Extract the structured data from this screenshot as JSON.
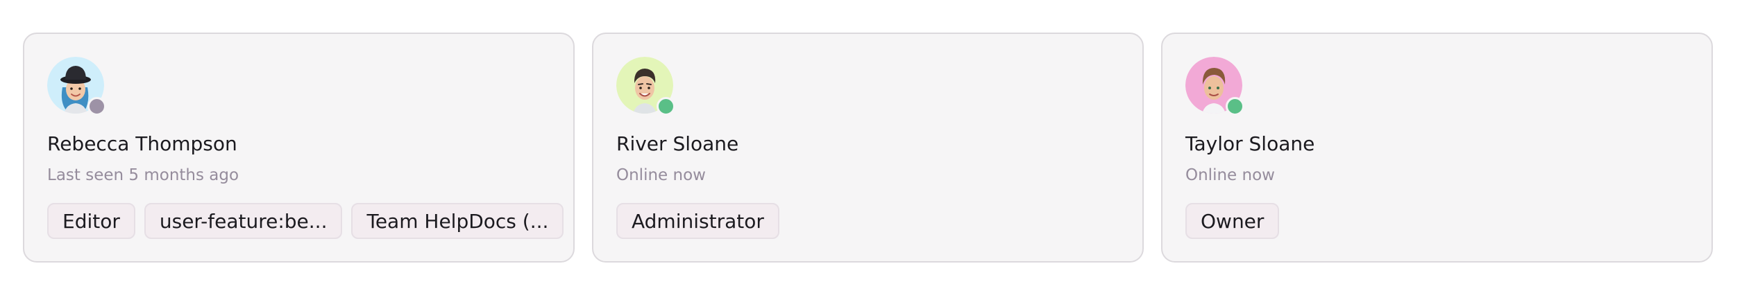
{
  "members": [
    {
      "name": "Rebecca Thompson",
      "status_text": "Last seen 5 months ago",
      "online": false,
      "avatar_icon": "memoji-woman-black-hat-blue-hair",
      "avatar_bg": "#cfeefb",
      "tags": [
        "Editor",
        "user-feature:be...",
        "Team HelpDocs (..."
      ]
    },
    {
      "name": "River Sloane",
      "status_text": "Online now",
      "online": true,
      "avatar_icon": "memoji-man-dark-hair",
      "avatar_bg": "#e3f5b8",
      "tags": [
        "Administrator"
      ]
    },
    {
      "name": "Taylor Sloane",
      "status_text": "Online now",
      "online": true,
      "avatar_icon": "memoji-man-brown-hair",
      "avatar_bg": "#f2a9d6",
      "tags": [
        "Owner"
      ]
    }
  ],
  "colors": {
    "online": "#5abf87",
    "offline": "#9d92a6"
  }
}
